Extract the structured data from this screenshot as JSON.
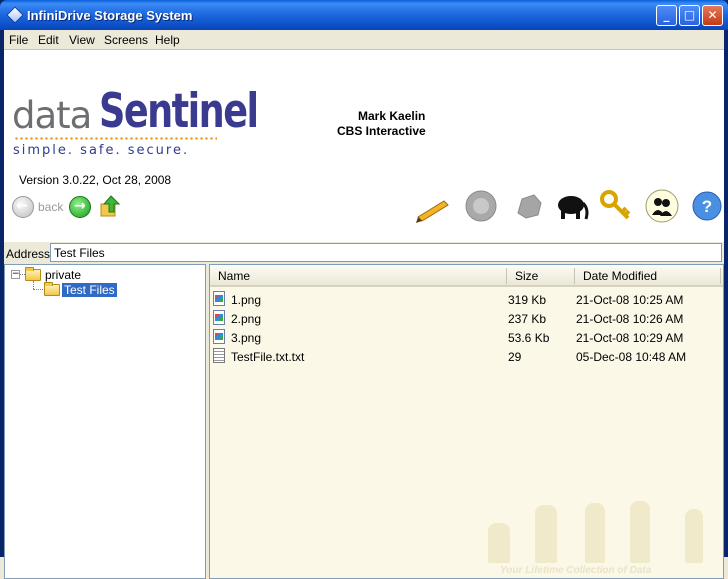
{
  "window": {
    "title": "InfiniDrive Storage System",
    "controls": {
      "minimize": "_",
      "maximize": "□",
      "close": "✕"
    }
  },
  "menu": [
    "File",
    "Edit",
    "View",
    "Screens",
    "Help"
  ],
  "banner": {
    "logo_part1": "data",
    "logo_part2": "Sentinel",
    "tagline": "simple.  safe.  secure.",
    "user_name": "Mark Kaelin",
    "organization": "CBS Interactive",
    "version": "Version 3.0.22,  Oct 28, 2008",
    "back_label": "back"
  },
  "toolbar_icons": [
    "pencil-icon",
    "disc-icon",
    "stone-icon",
    "elephant-icon",
    "key-icon",
    "users-icon",
    "help-icon"
  ],
  "address": {
    "label": "Address:",
    "value": "Test Files"
  },
  "tree": {
    "root": "private",
    "child": "Test Files"
  },
  "list": {
    "columns": [
      "Name",
      "Size",
      "Date Modified"
    ],
    "rows": [
      {
        "name": "1.png",
        "size": "319 Kb",
        "date": "21-Oct-08 10:25 AM",
        "type": "image"
      },
      {
        "name": "2.png",
        "size": "237 Kb",
        "date": "21-Oct-08 10:26 AM",
        "type": "image"
      },
      {
        "name": "3.png",
        "size": "53.6 Kb",
        "date": "21-Oct-08 10:29 AM",
        "type": "image"
      },
      {
        "name": "TestFile.txt.txt",
        "size": "29",
        "date": "05-Dec-08 10:48 AM",
        "type": "text"
      }
    ],
    "watermark": "Your Lifetime Collection of Data"
  },
  "colors": {
    "title_blue": "#0c4fc9",
    "logo_blue": "#3a3b8f",
    "logo_orange": "#f29b1d",
    "selection": "#316ac5"
  }
}
